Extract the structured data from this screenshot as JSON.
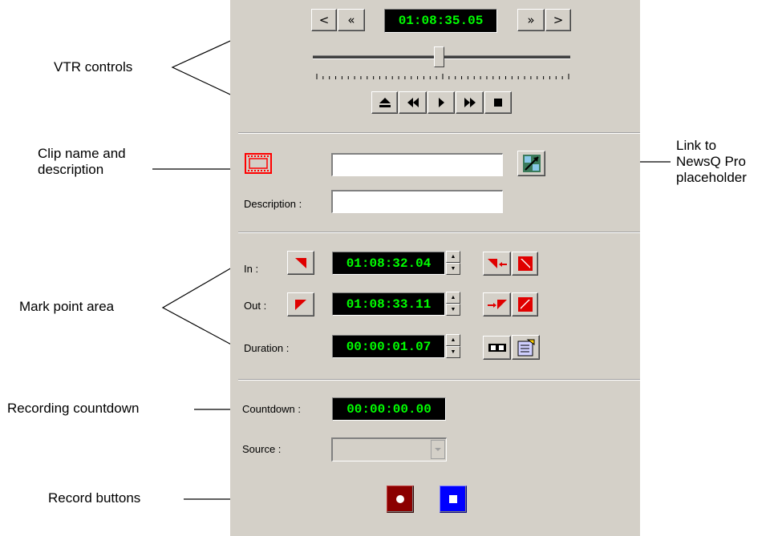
{
  "vtr": {
    "timecode": "01:08:35.05",
    "shuttle_position": 0.49
  },
  "clip": {
    "name_value": "",
    "description_label": "Description :",
    "description_value": ""
  },
  "marks": {
    "in_label": "In :",
    "in_timecode": "01:08:32.04",
    "out_label": "Out :",
    "out_timecode": "01:08:33.11",
    "duration_label": "Duration :",
    "duration_timecode": "00:00:01.07"
  },
  "record": {
    "countdown_label": "Countdown :",
    "countdown_value": "00:00:00.00",
    "source_label": "Source :",
    "source_value": ""
  },
  "callouts": {
    "vtr_controls": "VTR controls",
    "clip_name_line1": "Clip name and",
    "clip_name_line2": "description",
    "link_line1": "Link to",
    "link_line2": "NewsQ Pro",
    "link_line3": "placeholder",
    "mark_point_area": "Mark point area",
    "recording_countdown": "Recording countdown",
    "record_buttons": "Record buttons"
  },
  "colors": {
    "panel": "#d4d0c8",
    "timecode_text": "#00ff00",
    "mark_red": "#e00000",
    "record_button": "#8b0000",
    "stop_button": "#0000ff"
  },
  "icons": {
    "clip": "filmstrip-icon",
    "link": "newsq-link-icon",
    "eject": "eject-icon",
    "rewind": "rewind-icon",
    "play": "play-icon",
    "fast_forward": "fast-forward-icon",
    "stop": "stop-icon"
  }
}
